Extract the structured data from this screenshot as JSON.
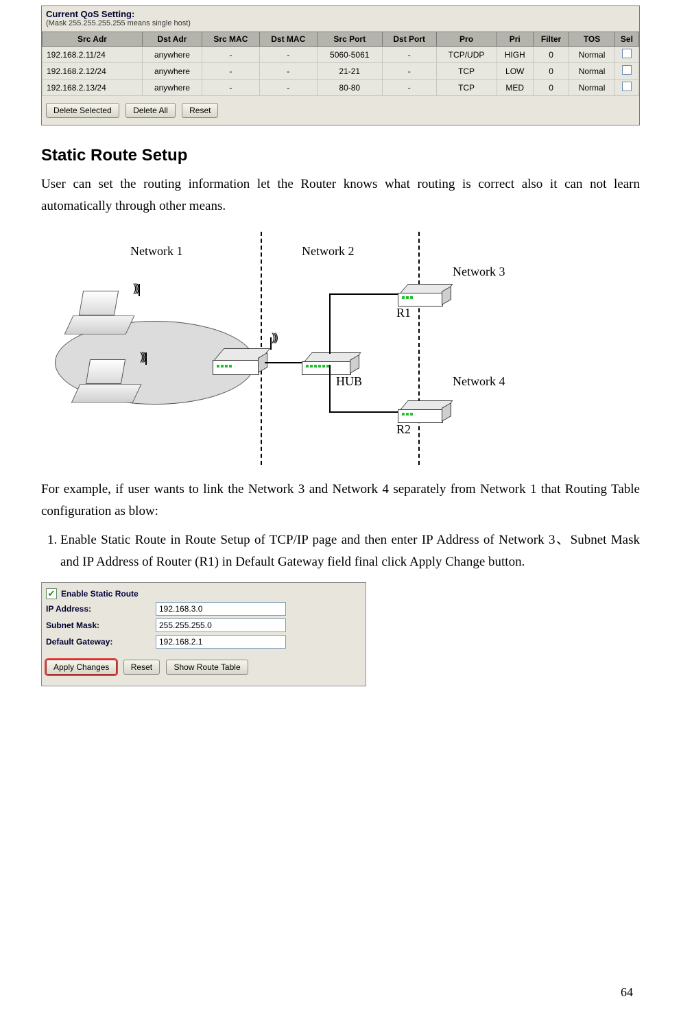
{
  "qos": {
    "title": "Current QoS Setting:",
    "subtitle": "(Mask 255.255.255.255 means single host)",
    "headers": [
      "Src Adr",
      "Dst Adr",
      "Src MAC",
      "Dst MAC",
      "Src Port",
      "Dst Port",
      "Pro",
      "Pri",
      "Filter",
      "TOS",
      "Sel"
    ],
    "rows": [
      {
        "src": "192.168.2.11/24",
        "dst": "anywhere",
        "smac": "-",
        "dmac": "-",
        "sport": "5060-5061",
        "dport": "-",
        "pro": "TCP/UDP",
        "pri": "HIGH",
        "filter": "0",
        "tos": "Normal"
      },
      {
        "src": "192.168.2.12/24",
        "dst": "anywhere",
        "smac": "-",
        "dmac": "-",
        "sport": "21-21",
        "dport": "-",
        "pro": "TCP",
        "pri": "LOW",
        "filter": "0",
        "tos": "Normal"
      },
      {
        "src": "192.168.2.13/24",
        "dst": "anywhere",
        "smac": "-",
        "dmac": "-",
        "sport": "80-80",
        "dport": "-",
        "pro": "TCP",
        "pri": "MED",
        "filter": "0",
        "tos": "Normal"
      }
    ],
    "buttons": {
      "delete_selected": "Delete Selected",
      "delete_all": "Delete All",
      "reset": "Reset"
    }
  },
  "section_title": "Static Route Setup",
  "para1": "User can set the routing information let the Router knows what routing is correct also it can not learn automatically through other means.",
  "diagram": {
    "n1": "Network 1",
    "n2": "Network 2",
    "n3": "Network 3",
    "n4": "Network 4",
    "hub": "HUB",
    "r1": "R1",
    "r2": "R2"
  },
  "para2": "For example,  if  user  wants to  link the  Network 3  and  Network 4   separately from Network 1 that Routing Table configuration as blow:",
  "step1": "Enable Static Route in Route Setup of TCP/IP page and then enter IP Address of Network 3、Subnet Mask and IP Address of Router (R1) in Default Gateway field final click Apply Change button.",
  "form": {
    "enable": "Enable Static Route",
    "ip_label": "IP Address:",
    "ip_val": "192.168.3.0",
    "mask_label": "Subnet Mask:",
    "mask_val": "255.255.255.0",
    "gw_label": "Default Gateway:",
    "gw_val": "192.168.2.1",
    "apply": "Apply Changes",
    "reset": "Reset",
    "show": "Show Route Table"
  },
  "page_no": "64"
}
